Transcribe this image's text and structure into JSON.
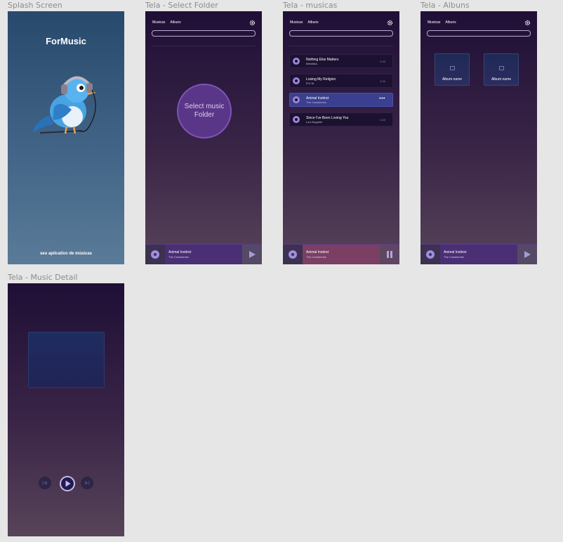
{
  "frames": {
    "splash": {
      "label": "Splash Screen",
      "app_name": "ForMusic",
      "tagline": "seu aplicativo de músicas",
      "illustration": "bird-with-headphones"
    },
    "select_folder": {
      "label": "Tela - Select Folder",
      "button": "Select music Folder"
    },
    "musicas": {
      "label": "Tela - musicas"
    },
    "albuns": {
      "label": "Tela - Albuns",
      "albums": [
        {
          "name": "Album name"
        },
        {
          "name": "Album name"
        }
      ]
    },
    "detail": {
      "label": "Tela - Music Detail"
    }
  },
  "nav": {
    "tab_musicas": "Musicas",
    "tab_albuns": "Albuns",
    "settings_icon": "gear-icon"
  },
  "tracks": [
    {
      "title": "Nothing Else Matters",
      "artist": "Metallica",
      "time": "3:30"
    },
    {
      "title": "Losing My Religion",
      "artist": "R.E.M",
      "time": "3:30"
    },
    {
      "title": "Animal Instinct",
      "artist": "The Cranberries",
      "more": "•••",
      "active": true
    },
    {
      "title": "Since I've Been Loving You",
      "artist": "Led Zeppelin",
      "time": "3:30"
    }
  ],
  "player": {
    "title": "Animal Instinct",
    "artist": "The Cranberries"
  },
  "colors": {
    "canvas": "#e6e6e6",
    "app_top": "#1f0f36",
    "accent_purple": "#5a3688",
    "active_row": "#3b3f8f",
    "splash_blue": "#27496c"
  }
}
